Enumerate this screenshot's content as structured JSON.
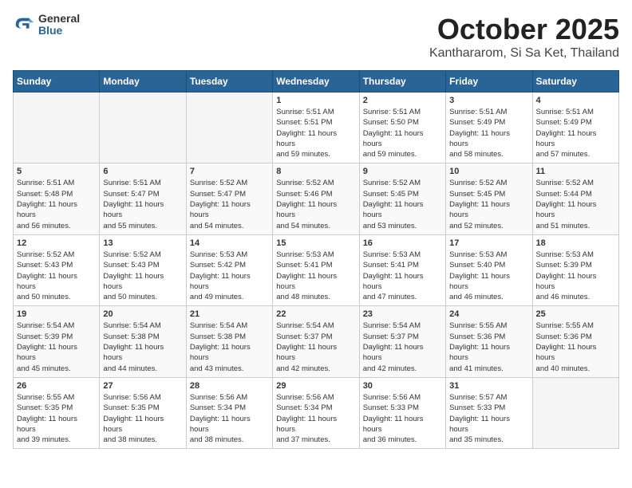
{
  "header": {
    "logo_general": "General",
    "logo_blue": "Blue",
    "title": "October 2025",
    "subtitle": "Kanthararom, Si Sa Ket, Thailand"
  },
  "weekdays": [
    "Sunday",
    "Monday",
    "Tuesday",
    "Wednesday",
    "Thursday",
    "Friday",
    "Saturday"
  ],
  "weeks": [
    [
      {
        "day": "",
        "info": ""
      },
      {
        "day": "",
        "info": ""
      },
      {
        "day": "",
        "info": ""
      },
      {
        "day": "1",
        "info": "Sunrise: 5:51 AM\nSunset: 5:51 PM\nDaylight: 11 hours and 59 minutes."
      },
      {
        "day": "2",
        "info": "Sunrise: 5:51 AM\nSunset: 5:50 PM\nDaylight: 11 hours and 59 minutes."
      },
      {
        "day": "3",
        "info": "Sunrise: 5:51 AM\nSunset: 5:49 PM\nDaylight: 11 hours and 58 minutes."
      },
      {
        "day": "4",
        "info": "Sunrise: 5:51 AM\nSunset: 5:49 PM\nDaylight: 11 hours and 57 minutes."
      }
    ],
    [
      {
        "day": "5",
        "info": "Sunrise: 5:51 AM\nSunset: 5:48 PM\nDaylight: 11 hours and 56 minutes."
      },
      {
        "day": "6",
        "info": "Sunrise: 5:51 AM\nSunset: 5:47 PM\nDaylight: 11 hours and 55 minutes."
      },
      {
        "day": "7",
        "info": "Sunrise: 5:52 AM\nSunset: 5:47 PM\nDaylight: 11 hours and 54 minutes."
      },
      {
        "day": "8",
        "info": "Sunrise: 5:52 AM\nSunset: 5:46 PM\nDaylight: 11 hours and 54 minutes."
      },
      {
        "day": "9",
        "info": "Sunrise: 5:52 AM\nSunset: 5:45 PM\nDaylight: 11 hours and 53 minutes."
      },
      {
        "day": "10",
        "info": "Sunrise: 5:52 AM\nSunset: 5:45 PM\nDaylight: 11 hours and 52 minutes."
      },
      {
        "day": "11",
        "info": "Sunrise: 5:52 AM\nSunset: 5:44 PM\nDaylight: 11 hours and 51 minutes."
      }
    ],
    [
      {
        "day": "12",
        "info": "Sunrise: 5:52 AM\nSunset: 5:43 PM\nDaylight: 11 hours and 50 minutes."
      },
      {
        "day": "13",
        "info": "Sunrise: 5:52 AM\nSunset: 5:43 PM\nDaylight: 11 hours and 50 minutes."
      },
      {
        "day": "14",
        "info": "Sunrise: 5:53 AM\nSunset: 5:42 PM\nDaylight: 11 hours and 49 minutes."
      },
      {
        "day": "15",
        "info": "Sunrise: 5:53 AM\nSunset: 5:41 PM\nDaylight: 11 hours and 48 minutes."
      },
      {
        "day": "16",
        "info": "Sunrise: 5:53 AM\nSunset: 5:41 PM\nDaylight: 11 hours and 47 minutes."
      },
      {
        "day": "17",
        "info": "Sunrise: 5:53 AM\nSunset: 5:40 PM\nDaylight: 11 hours and 46 minutes."
      },
      {
        "day": "18",
        "info": "Sunrise: 5:53 AM\nSunset: 5:39 PM\nDaylight: 11 hours and 46 minutes."
      }
    ],
    [
      {
        "day": "19",
        "info": "Sunrise: 5:54 AM\nSunset: 5:39 PM\nDaylight: 11 hours and 45 minutes."
      },
      {
        "day": "20",
        "info": "Sunrise: 5:54 AM\nSunset: 5:38 PM\nDaylight: 11 hours and 44 minutes."
      },
      {
        "day": "21",
        "info": "Sunrise: 5:54 AM\nSunset: 5:38 PM\nDaylight: 11 hours and 43 minutes."
      },
      {
        "day": "22",
        "info": "Sunrise: 5:54 AM\nSunset: 5:37 PM\nDaylight: 11 hours and 42 minutes."
      },
      {
        "day": "23",
        "info": "Sunrise: 5:54 AM\nSunset: 5:37 PM\nDaylight: 11 hours and 42 minutes."
      },
      {
        "day": "24",
        "info": "Sunrise: 5:55 AM\nSunset: 5:36 PM\nDaylight: 11 hours and 41 minutes."
      },
      {
        "day": "25",
        "info": "Sunrise: 5:55 AM\nSunset: 5:36 PM\nDaylight: 11 hours and 40 minutes."
      }
    ],
    [
      {
        "day": "26",
        "info": "Sunrise: 5:55 AM\nSunset: 5:35 PM\nDaylight: 11 hours and 39 minutes."
      },
      {
        "day": "27",
        "info": "Sunrise: 5:56 AM\nSunset: 5:35 PM\nDaylight: 11 hours and 38 minutes."
      },
      {
        "day": "28",
        "info": "Sunrise: 5:56 AM\nSunset: 5:34 PM\nDaylight: 11 hours and 38 minutes."
      },
      {
        "day": "29",
        "info": "Sunrise: 5:56 AM\nSunset: 5:34 PM\nDaylight: 11 hours and 37 minutes."
      },
      {
        "day": "30",
        "info": "Sunrise: 5:56 AM\nSunset: 5:33 PM\nDaylight: 11 hours and 36 minutes."
      },
      {
        "day": "31",
        "info": "Sunrise: 5:57 AM\nSunset: 5:33 PM\nDaylight: 11 hours and 35 minutes."
      },
      {
        "day": "",
        "info": ""
      }
    ]
  ]
}
